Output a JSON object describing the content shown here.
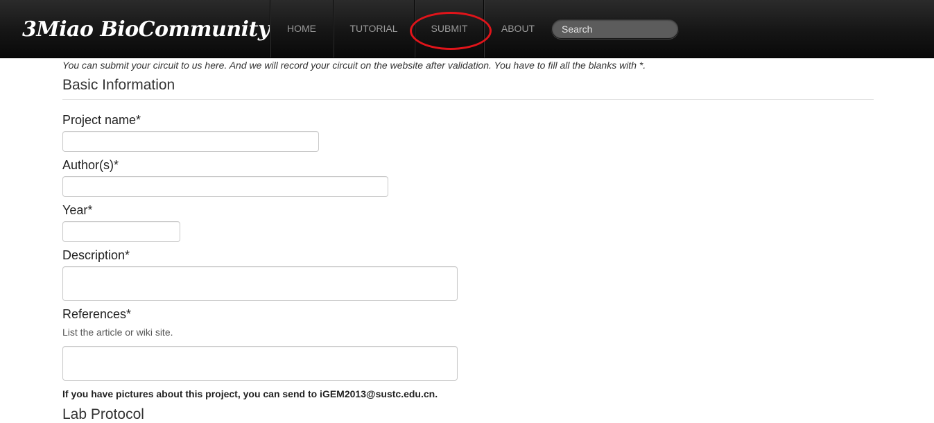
{
  "brand": {
    "name": "3Miao BioCommunity",
    "logo_icon": "cat-head-icon"
  },
  "nav": {
    "items": [
      {
        "label": "HOME"
      },
      {
        "label": "TUTORIAL"
      },
      {
        "label": "SUBMIT",
        "highlighted": true
      },
      {
        "label": "ABOUT"
      }
    ],
    "search": {
      "placeholder": "Search",
      "value": ""
    }
  },
  "colors": {
    "navbar_bg": "#151515",
    "nav_text": "#9a9a9a",
    "highlight_ring": "#e0141a",
    "search_bg": "#5c5c5c"
  },
  "form": {
    "intro": "You can submit your circuit to us here. And we will record your circuit on the website after validation. You have to fill all the blanks with *.",
    "section_title": "Basic Information",
    "fields": {
      "project_name": {
        "label": "Project name*",
        "value": ""
      },
      "authors": {
        "label": "Author(s)*",
        "value": ""
      },
      "year": {
        "label": "Year*",
        "value": ""
      },
      "description": {
        "label": "Description*",
        "value": ""
      },
      "references": {
        "label": "References*",
        "help": "List the article or wiki site.",
        "value": ""
      }
    },
    "pictures_note": "If you have pictures about this project, you can send to iGEM2013@sustc.edu.cn.",
    "next_section_title": "Lab Protocol"
  }
}
